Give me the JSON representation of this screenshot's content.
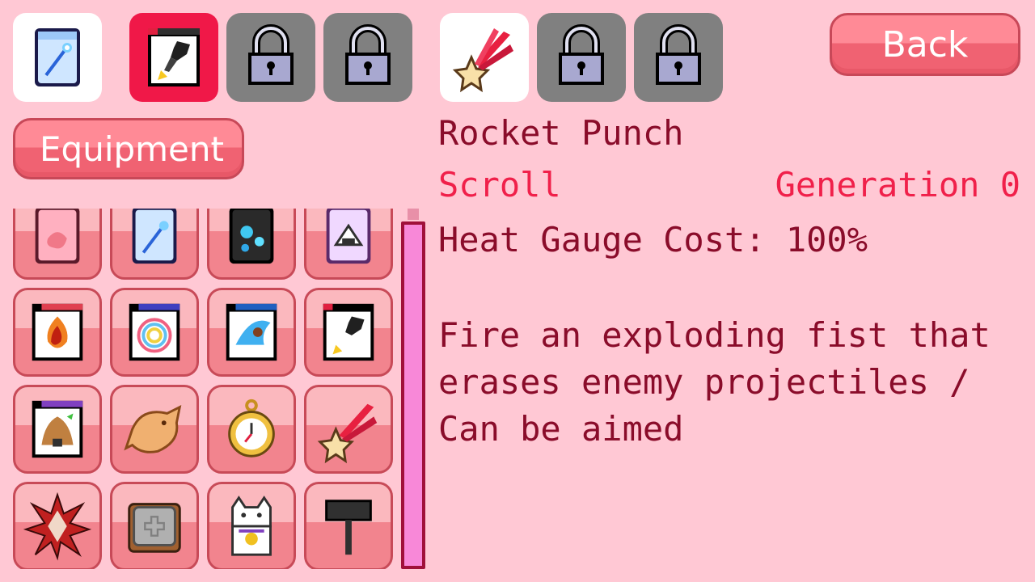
{
  "header": {
    "back_label": "Back",
    "equipment_label": "Equipment"
  },
  "slots": [
    {
      "icon": "ice-wand-card-icon",
      "state": "filled"
    },
    {
      "icon": "rocket-fist-scroll-icon",
      "state": "selected"
    },
    {
      "icon": "lock-icon",
      "state": "locked"
    },
    {
      "icon": "lock-icon",
      "state": "locked"
    },
    {
      "icon": "feather-star-charm-icon",
      "state": "filled"
    },
    {
      "icon": "lock-icon",
      "state": "locked"
    },
    {
      "icon": "lock-icon",
      "state": "locked"
    }
  ],
  "inventory": [
    "pink-card-icon",
    "ice-wand-card-icon",
    "blue-orb-card-icon",
    "rice-ball-card-icon",
    "fire-scroll-icon",
    "rainbow-orb-scroll-icon",
    "water-splash-scroll-icon",
    "rocket-fist-scroll-icon",
    "beehive-scroll-icon",
    "taiyaki-icon",
    "pocket-watch-icon",
    "feather-star-charm-icon",
    "spiky-gem-icon",
    "stone-tablet-icon",
    "lucky-cat-icon",
    "hammer-icon"
  ],
  "detail": {
    "name": "Rocket Punch",
    "category": "Scroll",
    "generation": "Generation 0",
    "cost": "Heat Gauge Cost: 100%",
    "description": "Fire an exploding fist that erases enemy projectiles / Can be aimed"
  },
  "colors": {
    "background": "#ffc8d4",
    "selected": "#f01848",
    "accent_text": "#f0204a",
    "body_text": "#8a0c2a",
    "scroll_thumb": "#f888d8"
  }
}
